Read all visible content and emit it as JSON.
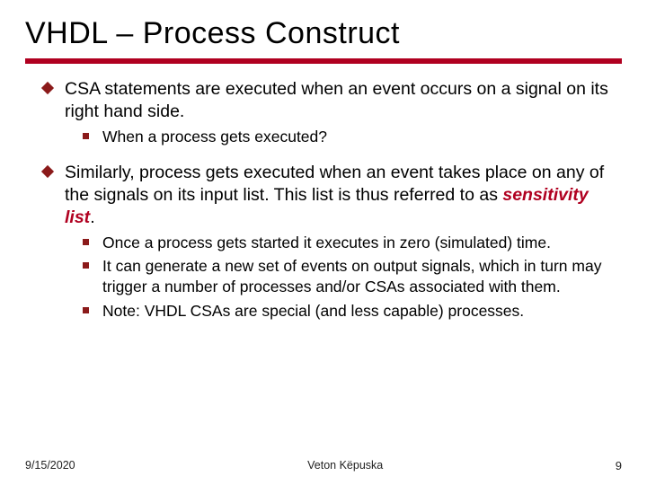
{
  "title": "VHDL – Process Construct",
  "bullets": {
    "b1": {
      "text": "CSA statements are executed when an event occurs on a signal on its right hand side.",
      "sub1": "When a process gets executed?"
    },
    "b2": {
      "text_prefix": "Similarly, process gets executed when an event takes place on any of the signals on its input list. This list is thus referred to as ",
      "sensitivity": "sensitivity list",
      "text_suffix": ".",
      "sub1": "Once a process gets started it executes in zero (simulated) time.",
      "sub2": "It can generate a new set of events on output signals, which in turn may trigger a number of processes and/or CSAs associated with them.",
      "sub3": "Note: VHDL CSAs are special (and less capable) processes."
    }
  },
  "footer": {
    "date": "9/15/2020",
    "author": "Veton Këpuska",
    "page": "9"
  }
}
